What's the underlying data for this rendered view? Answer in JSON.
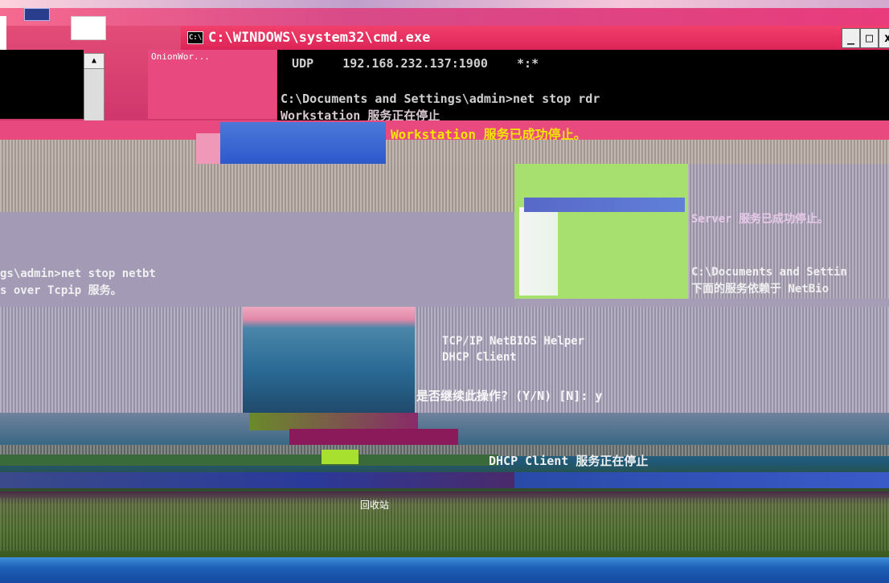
{
  "window": {
    "title": "C:\\WINDOWS\\system32\\cmd.exe",
    "icon_text": "C:\\",
    "minimize_label": "_",
    "maximize_label": "□",
    "close_label": "x"
  },
  "minor_window": {
    "label": "OnionWor..."
  },
  "console": {
    "lines": [
      "  UDP    192.168.232.137:1900    *:*",
      "C:\\Documents and Settings\\admin>net stop rdr",
      "Workstation 服务正在停止",
      "Workstation 服务已成功停止。"
    ]
  },
  "scattered_text": {
    "server_stopped": "Server 服务已成功停止。",
    "cmd_netbt": "gs\\admin>net stop netbt",
    "netbt_service": "s over Tcpip 服务。",
    "docs_path": "C:\\Documents and Settin",
    "depends_on": "下面的服务依赖于 NetBio",
    "dep_helper": "TCP/IP NetBIOS Helper",
    "dep_dhcp": "DHCP Client",
    "prompt": "是否继续此操作? (Y/N) [N]: y",
    "dhcp_stopping": "DHCP Client 服务正在停止",
    "recycle_bin": "回收站"
  },
  "colors": {
    "title_bar": "#db2457",
    "console_bg": "#000000",
    "console_text": "#c0c0c0",
    "yellow_text": "#f2e600",
    "desktop_pink": "#e84a80",
    "desktop_green": "#a8e070"
  },
  "icons": [
    "cmd-icon",
    "minimize-icon",
    "maximize-icon",
    "close-icon",
    "scroll-up-icon",
    "recycle-bin-icon"
  ]
}
